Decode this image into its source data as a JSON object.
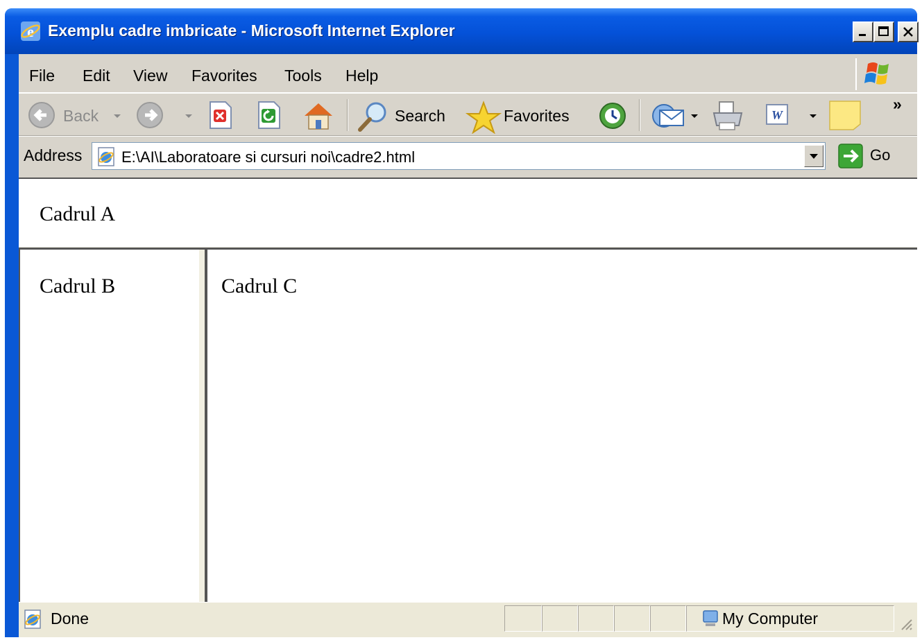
{
  "window": {
    "title": "Exemplu cadre imbricate - Microsoft Internet Explorer"
  },
  "menu": {
    "items": [
      "File",
      "Edit",
      "View",
      "Favorites",
      "Tools",
      "Help"
    ]
  },
  "toolbar": {
    "back_label": "Back",
    "search_label": "Search",
    "favorites_label": "Favorites",
    "chevron": "»",
    "icons": [
      "back-icon",
      "forward-icon",
      "stop-icon",
      "refresh-icon",
      "home-icon",
      "search-icon",
      "favorites-icon",
      "history-icon",
      "mail-icon",
      "print-icon",
      "edit-icon",
      "notes-icon"
    ]
  },
  "address": {
    "label": "Address",
    "url": "E:\\AI\\Laboratoare si cursuri noi\\cadre2.html",
    "go_label": "Go"
  },
  "frames": {
    "a": "Cadrul A",
    "b": "Cadrul B",
    "c": "Cadrul C"
  },
  "status": {
    "text": "Done",
    "zone": "My Computer"
  },
  "colors": {
    "title_bar": "#0451D8",
    "chrome": "#D8D4CB",
    "page": "#ffffff"
  }
}
